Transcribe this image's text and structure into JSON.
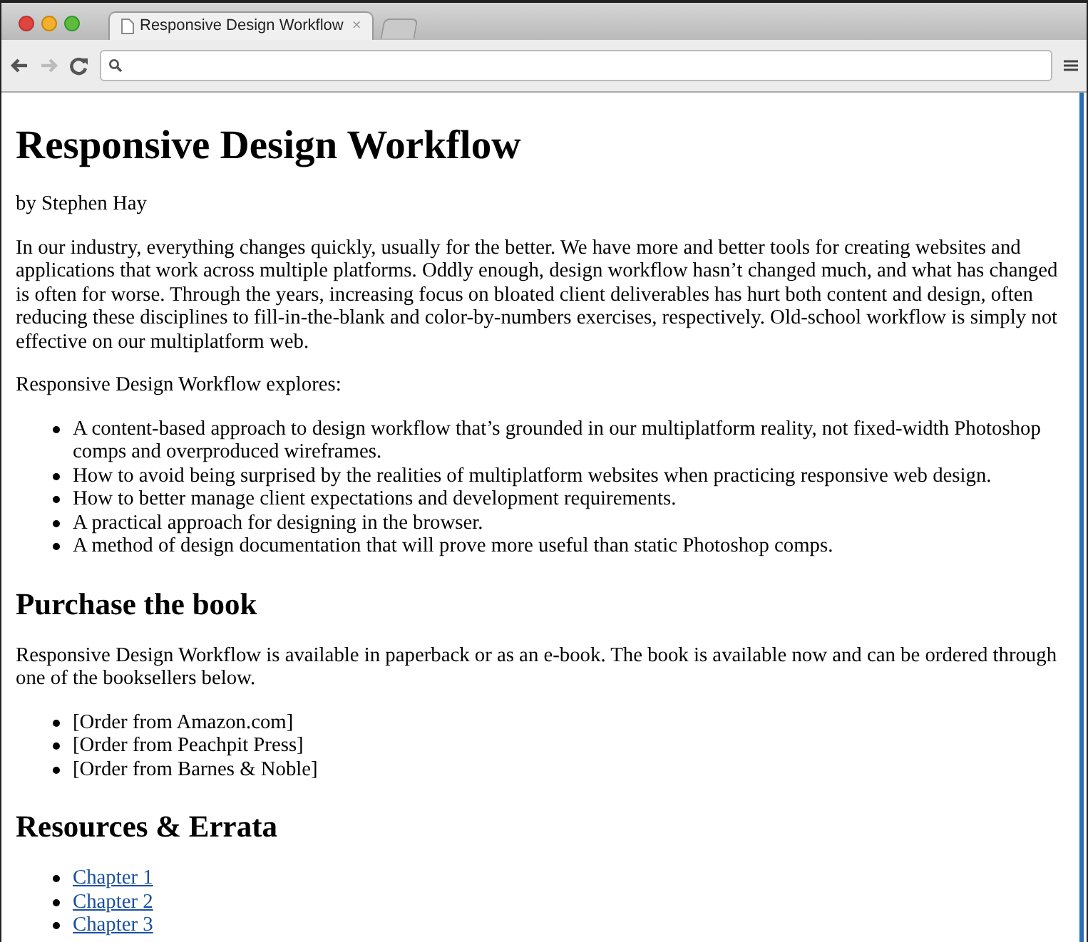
{
  "browser": {
    "tabs": [
      {
        "title": "Responsive Design Workflow",
        "close": "×",
        "selected": true
      }
    ]
  },
  "page": {
    "title": "Responsive Design Workflow",
    "byline": "by Stephen Hay",
    "intro": "In our industry, everything changes quickly, usually for the better. We have more and better tools for creating websites and applications that work across multiple platforms. Oddly enough, design workflow hasn’t changed much, and what has changed is often for worse. Through the years, increasing focus on bloated client deliverables has hurt both content and design, often reducing these disciplines to fill-in-the-blank and color-by-numbers exercises, respectively. Old-school workflow is simply not effective on our multiplatform web.",
    "explores_label": "Responsive Design Workflow explores:",
    "explores": [
      "A content-based approach to design workflow that’s grounded in our multiplatform reality, not fixed-width Photoshop comps and overproduced wireframes.",
      "How to avoid being surprised by the realities of multiplatform websites when practicing responsive web design.",
      "How to better manage client expectations and development requirements.",
      "A practical approach for designing in the browser.",
      "A method of design documentation that will prove more useful than static Photoshop comps."
    ],
    "purchase_heading": "Purchase the book",
    "purchase_text": "Responsive Design Workflow is available in paperback or as an e-book. The book is available now and can be ordered through one of the booksellers below.",
    "sellers": [
      "[Order from Amazon.com]",
      "[Order from Peachpit Press]",
      "[Order from Barnes & Noble]"
    ],
    "resources_heading": "Resources & Errata",
    "chapters": [
      "Chapter 1",
      "Chapter 2",
      "Chapter 3"
    ]
  }
}
